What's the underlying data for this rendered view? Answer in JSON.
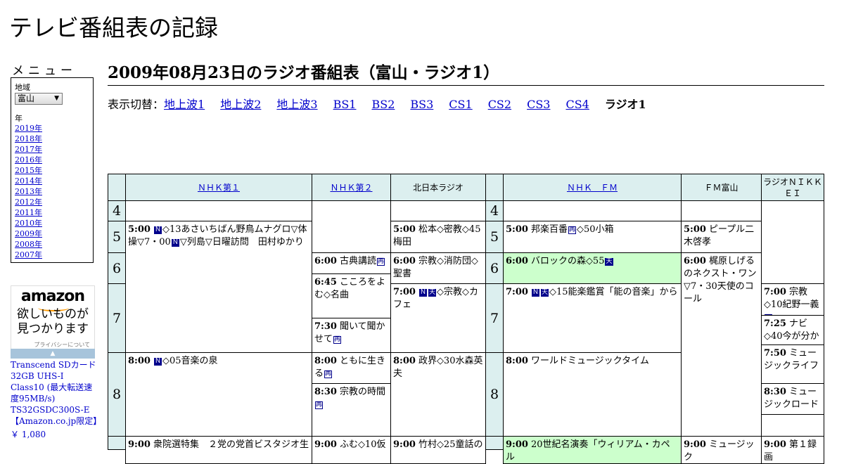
{
  "site": {
    "title": "テレビ番組表の記録"
  },
  "menu": {
    "label": "メニュー",
    "region_label": "地域",
    "region_value": "富山",
    "year_label": "年",
    "years": [
      "2019年",
      "2018年",
      "2017年",
      "2016年",
      "2015年",
      "2014年",
      "2013年",
      "2012年",
      "2011年",
      "2010年",
      "2009年",
      "2008年",
      "2007年"
    ]
  },
  "ad": {
    "logo": "amazon",
    "tagline_line1": "欲しいものが",
    "tagline_line2": "見つかります",
    "privacy": "プライバシーについて",
    "product": "Transcend SDカード 32GB UHS-I Class10 (最大転送速度95MB/s) TS32GSDC300S-E【Amazon.co.jp限定】",
    "price": "￥ 1,080"
  },
  "page": {
    "heading": "2009年08月23日のラジオ番組表（富山・ラジオ1）",
    "switch_label": "表示切替：",
    "switch_links": [
      "地上波1",
      "地上波2",
      "地上波3",
      "BS1",
      "BS2",
      "BS3",
      "CS1",
      "CS2",
      "CS3",
      "CS4"
    ],
    "switch_current": "ラジオ1"
  },
  "schedule": {
    "channels": [
      "ＮＨＫ第１",
      "ＮＨＫ第２",
      "北日本ラジオ",
      "ＮＨＫ　ＦＭ",
      "ＦＭ富山",
      "ラジオＮＩＫＫＥＩ"
    ],
    "hours": [
      "4",
      "5",
      "6",
      "7",
      "8"
    ],
    "marks": {
      "news": "Ｎ",
      "weather": "天",
      "rerun": "再"
    },
    "programs": {
      "nhk1_0500": {
        "time": "5:00",
        "title": "◇13あさいちばん野鳥ムナグロ▽体操▽7・00",
        "title2": "▽列島▽日曜訪問　田村ゆかり"
      },
      "nhk1_0800": {
        "time": "8:00",
        "title": "◇05音楽の泉"
      },
      "nhk2_0600": {
        "time": "6:00",
        "title": "古典講読"
      },
      "nhk2_0645": {
        "time": "6:45",
        "title": "こころをよむ◇名曲"
      },
      "nhk2_0730": {
        "time": "7:30",
        "title": "聞いて聞かせて"
      },
      "nhk2_0800": {
        "time": "8:00",
        "title": "ともに生きる"
      },
      "nhk2_0830": {
        "time": "8:30",
        "title": "宗教の時間"
      },
      "knb_0500": {
        "time": "5:00",
        "title": "松本◇密教◇45梅田"
      },
      "knb_0600": {
        "time": "6:00",
        "title": "宗教◇消防団◇聖書"
      },
      "knb_0700": {
        "time": "7:00",
        "title": "◇宗教◇カフェ"
      },
      "knb_0800": {
        "time": "8:00",
        "title": "政界◇30水森英夫"
      },
      "fm_0500": {
        "time": "5:00",
        "title": "邦楽百番",
        "title2": "◇50小箱"
      },
      "fm_0600": {
        "time": "6:00",
        "title": "バロックの森◇55"
      },
      "fm_0700": {
        "time": "7:00",
        "title": "◇15能楽鑑賞「能の音楽」から"
      },
      "fm_0800": {
        "time": "8:00",
        "title": "ワールドミュージックタイム"
      },
      "fmt_0500": {
        "time": "5:00",
        "title": "ピープル二木啓孝"
      },
      "fmt_0600": {
        "time": "6:00",
        "title": "梶原しげるのネクスト・ワン▽7・30天使のコール"
      },
      "nikkei_0700": {
        "time": "7:00",
        "title": "宗教◇10紀野一義"
      },
      "nikkei_0725": {
        "time": "7:25",
        "title": "ナビ◇40今が分かる"
      },
      "nikkei_0750": {
        "time": "7:50",
        "title": "ミュージックライフ"
      },
      "nikkei_0830": {
        "time": "8:30",
        "title": "ミュージックロード"
      },
      "nhk1_0900": {
        "time": "9:00",
        "title": "衆院選特集　２党の党首ビスタジオ生"
      },
      "nhk2_0900": {
        "time": "9:00",
        "title": "ふむ◇10仮"
      },
      "knb_0900": {
        "time": "9:00",
        "title": "竹村◇25童話の"
      },
      "fm_0900": {
        "time": "9:00",
        "title": "20世紀名演奏「ウィリアム・カペル"
      },
      "fmt_0900": {
        "time": "9:00",
        "title": "ミュージック"
      },
      "nikkei_0900": {
        "time": "9:00",
        "title": "第１録画"
      }
    }
  },
  "colors": {
    "header_bg": "#dcefef",
    "highlight_bg": "#ccffcc",
    "link": "#0000cc",
    "mark_bg": "#00008b"
  }
}
